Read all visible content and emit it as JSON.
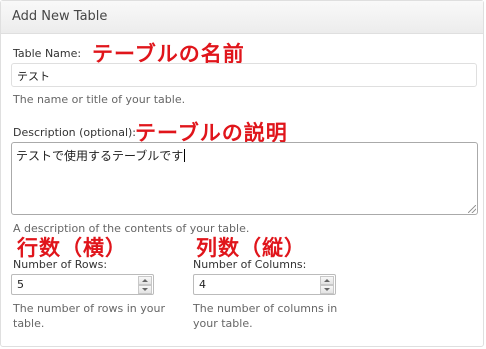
{
  "header": {
    "title": "Add New Table"
  },
  "name_field": {
    "label": "Table Name:",
    "value": "テスト",
    "hint": "The name or title of your table.",
    "annotation": "テーブルの名前"
  },
  "description_field": {
    "label": "Description (optional):",
    "value": "テストで使用するテーブルです",
    "hint": "A description of the contents of your table.",
    "annotation": "テーブルの説明"
  },
  "rows_field": {
    "label": "Number of Rows:",
    "value": "5",
    "hint_line1": "The number of rows in your",
    "hint_line2": "table.",
    "annotation": "行数（横）"
  },
  "columns_field": {
    "label": "Number of Columns:",
    "value": "4",
    "hint_line1": "The number of columns in",
    "hint_line2": "your table.",
    "annotation": "列数（縦）"
  },
  "colors": {
    "annotation": "#e0151b",
    "header_bg": "#ececec",
    "border": "#dfdfdf"
  },
  "icons": {
    "spinner_up": "triangle-up",
    "spinner_down": "triangle-down",
    "resize_grip": "diagonal-lines"
  }
}
